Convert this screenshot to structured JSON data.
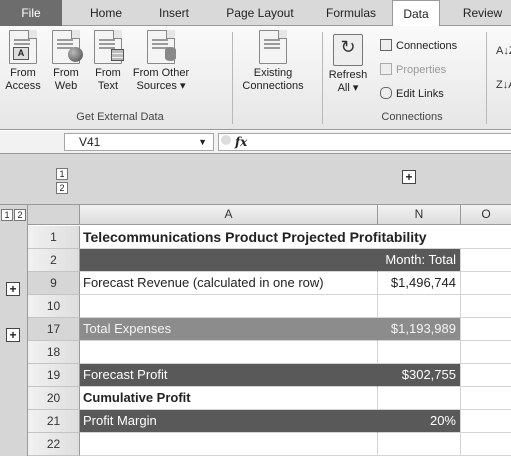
{
  "ribbon_tabs": [
    {
      "label": "File"
    },
    {
      "label": "Home"
    },
    {
      "label": "Insert"
    },
    {
      "label": "Page Layout"
    },
    {
      "label": "Formulas"
    },
    {
      "label": "Data"
    },
    {
      "label": "Review"
    }
  ],
  "ribbon": {
    "get_external_data": {
      "from_access": "From\nAccess",
      "from_web": "From\nWeb",
      "from_text": "From\nText",
      "from_other_sources": "From Other\nSources ▾",
      "group_label": "Get External Data"
    },
    "existing_connections": "Existing\nConnections",
    "connections": {
      "refresh_all": "Refresh\nAll ▾",
      "connections": "Connections",
      "properties": "Properties",
      "edit_links": "Edit Links",
      "group_label": "Connections"
    },
    "sort_icons": [
      "A↓Z",
      "Z↓A"
    ]
  },
  "formula_bar": {
    "name_box": "V41",
    "fx_label": "fx",
    "formula": ""
  },
  "outline": {
    "row_levels": [
      "1",
      "2"
    ],
    "col_levels": [
      "1",
      "2"
    ],
    "expand_symbol": "+"
  },
  "columns": [
    "A",
    "N",
    "O"
  ],
  "rows": [
    {
      "num": "1",
      "a": "Telecommunications Product Projected Profitability",
      "n": "",
      "style": "title"
    },
    {
      "num": "2",
      "a": "",
      "n": "Month: Total",
      "style": "dark"
    },
    {
      "num": "9",
      "a": "Forecast Revenue (calculated in one row)",
      "n": "$1,496,744",
      "style": "plain"
    },
    {
      "num": "10",
      "a": "",
      "n": "",
      "style": "plain"
    },
    {
      "num": "17",
      "a": "Total Expenses",
      "n": "$1,193,989",
      "style": "mid"
    },
    {
      "num": "18",
      "a": "",
      "n": "",
      "style": "plain"
    },
    {
      "num": "19",
      "a": "Forecast Profit",
      "n": "$302,755",
      "style": "dark"
    },
    {
      "num": "20",
      "a": "Cumulative Profit",
      "n": "",
      "style": "bold"
    },
    {
      "num": "21",
      "a": "Profit Margin",
      "n": "20%",
      "style": "dark"
    },
    {
      "num": "22",
      "a": "",
      "n": "",
      "style": "plain"
    }
  ],
  "colors": {
    "dark_band": "#595959",
    "mid_band": "#8c8c8c",
    "file_tab": "#6d6d6d"
  }
}
